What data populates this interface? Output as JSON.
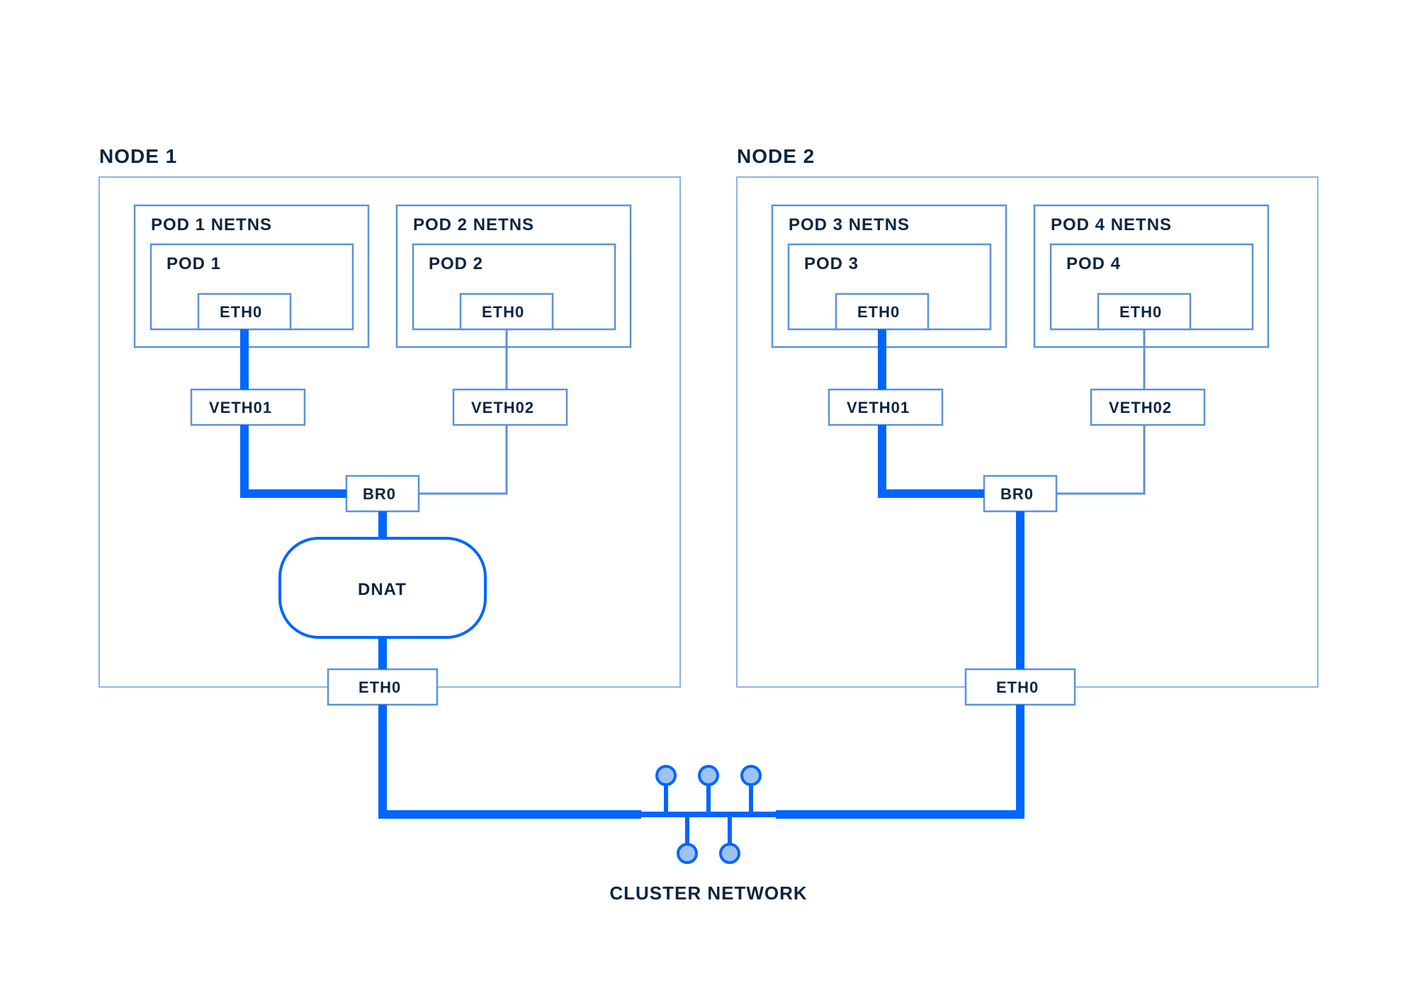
{
  "colors": {
    "dark_text": "#0a2540",
    "light_border": "#8bb4e8",
    "mid_border": "#5b92d8",
    "accent": "#0066ff",
    "dot_fill": "#9ec3f0"
  },
  "cluster_network_label": "CLUSTER NETWORK",
  "nodes": [
    {
      "title": "NODE 1",
      "bridge": "BR0",
      "host_eth": "ETH0",
      "dnat": "DNAT",
      "has_dnat": true,
      "pods": [
        {
          "netns": "POD 1 NETNS",
          "pod": "POD 1",
          "eth": "ETH0",
          "veth": "VETH01"
        },
        {
          "netns": "POD 2 NETNS",
          "pod": "POD 2",
          "eth": "ETH0",
          "veth": "VETH02"
        }
      ]
    },
    {
      "title": "NODE 2",
      "bridge": "BR0",
      "host_eth": "ETH0",
      "dnat": "",
      "has_dnat": false,
      "pods": [
        {
          "netns": "POD 3 NETNS",
          "pod": "POD 3",
          "eth": "ETH0",
          "veth": "VETH01"
        },
        {
          "netns": "POD 4 NETNS",
          "pod": "POD 4",
          "eth": "ETH0",
          "veth": "VETH02"
        }
      ]
    }
  ]
}
